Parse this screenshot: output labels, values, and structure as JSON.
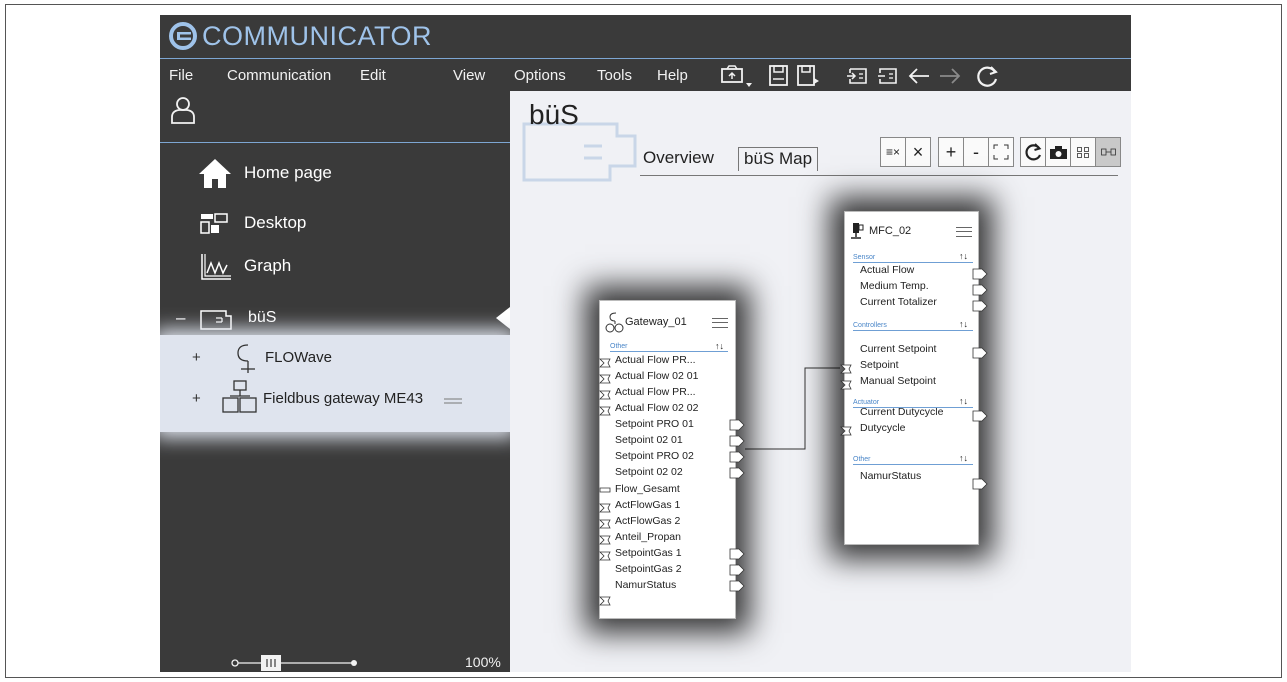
{
  "app": {
    "title": "COMMUNICATOR"
  },
  "menu": {
    "items": [
      {
        "label": "File"
      },
      {
        "label": "Communication"
      },
      {
        "label": "Edit"
      },
      {
        "label": "View"
      },
      {
        "label": "Options"
      },
      {
        "label": "Tools"
      },
      {
        "label": "Help"
      }
    ],
    "toolbar_icons": [
      "connect-icon",
      "save-icon",
      "save-as-icon",
      "import-icon",
      "export-icon",
      "back-arrow-icon",
      "forward-arrow-icon",
      "refresh-icon"
    ]
  },
  "sidebar": {
    "user_icon": "user-icon",
    "nav": [
      {
        "label": "Home page",
        "icon": "home-icon"
      },
      {
        "label": "Desktop",
        "icon": "desktop-icon"
      },
      {
        "label": "Graph",
        "icon": "graph-icon"
      }
    ],
    "bus": {
      "collapse": "–",
      "label": "büS",
      "icon": "bus-folder-icon"
    },
    "devices": [
      {
        "expand": "+",
        "label": "FLOWave",
        "icon": "flowave-icon"
      },
      {
        "expand": "+",
        "label": "Fieldbus gateway ME43",
        "icon": "gateway-icon"
      }
    ],
    "zoom": {
      "label": "100%"
    }
  },
  "main": {
    "title": "büS",
    "tabs": [
      {
        "label": "Overview"
      },
      {
        "label": "büS Map"
      }
    ],
    "tools": [
      {
        "label": "≡×",
        "icon": "clear-list-icon"
      },
      {
        "label": "×",
        "icon": "close-icon"
      },
      {
        "label": "+",
        "icon": "zoom-in-icon"
      },
      {
        "label": "-",
        "icon": "zoom-out-icon"
      },
      {
        "label": "",
        "icon": "fit-view-icon"
      },
      {
        "label": "",
        "icon": "reload-icon"
      },
      {
        "label": "",
        "icon": "camera-icon"
      },
      {
        "label": "",
        "icon": "grid-icon"
      },
      {
        "label": "",
        "icon": "link-icon"
      }
    ]
  },
  "gateway_node": {
    "title": "Gateway_01",
    "section": "Other",
    "arrows": "↑↓",
    "signals": [
      "Actual Flow PR...",
      "Actual Flow 02 01",
      "Actual Flow PR...",
      "Actual Flow 02 02",
      "Setpoint PRO 01",
      "Setpoint 02 01",
      "Setpoint PRO 02",
      "Setpoint 02 02",
      "Flow_Gesamt",
      "ActFlowGas 1",
      "ActFlowGas 2",
      "Anteil_Propan",
      "SetpointGas 1",
      "SetpointGas 2",
      "NamurStatus"
    ]
  },
  "mfc_node": {
    "title": "MFC_02",
    "arrows": "↑↓",
    "sections": [
      {
        "label": "Sensor",
        "signals": [
          "Actual Flow",
          "Medium Temp.",
          "Current Totalizer"
        ]
      },
      {
        "label": "Controllers",
        "signals": [
          "Current Setpoint",
          "Setpoint",
          "Manual Setpoint"
        ]
      },
      {
        "label": "Actuator",
        "signals": [
          "Current Dutycycle",
          "Dutycycle"
        ]
      },
      {
        "label": "Other",
        "signals": [
          "NamurStatus"
        ]
      }
    ]
  },
  "colors": {
    "app_bg": "#3a3a3a",
    "accent": "#7da6d3",
    "title": "#9fc3ea",
    "panel_bg": "#f0f1f5",
    "device_bg": "#dfe4ee",
    "section_label": "#4a86c8"
  }
}
